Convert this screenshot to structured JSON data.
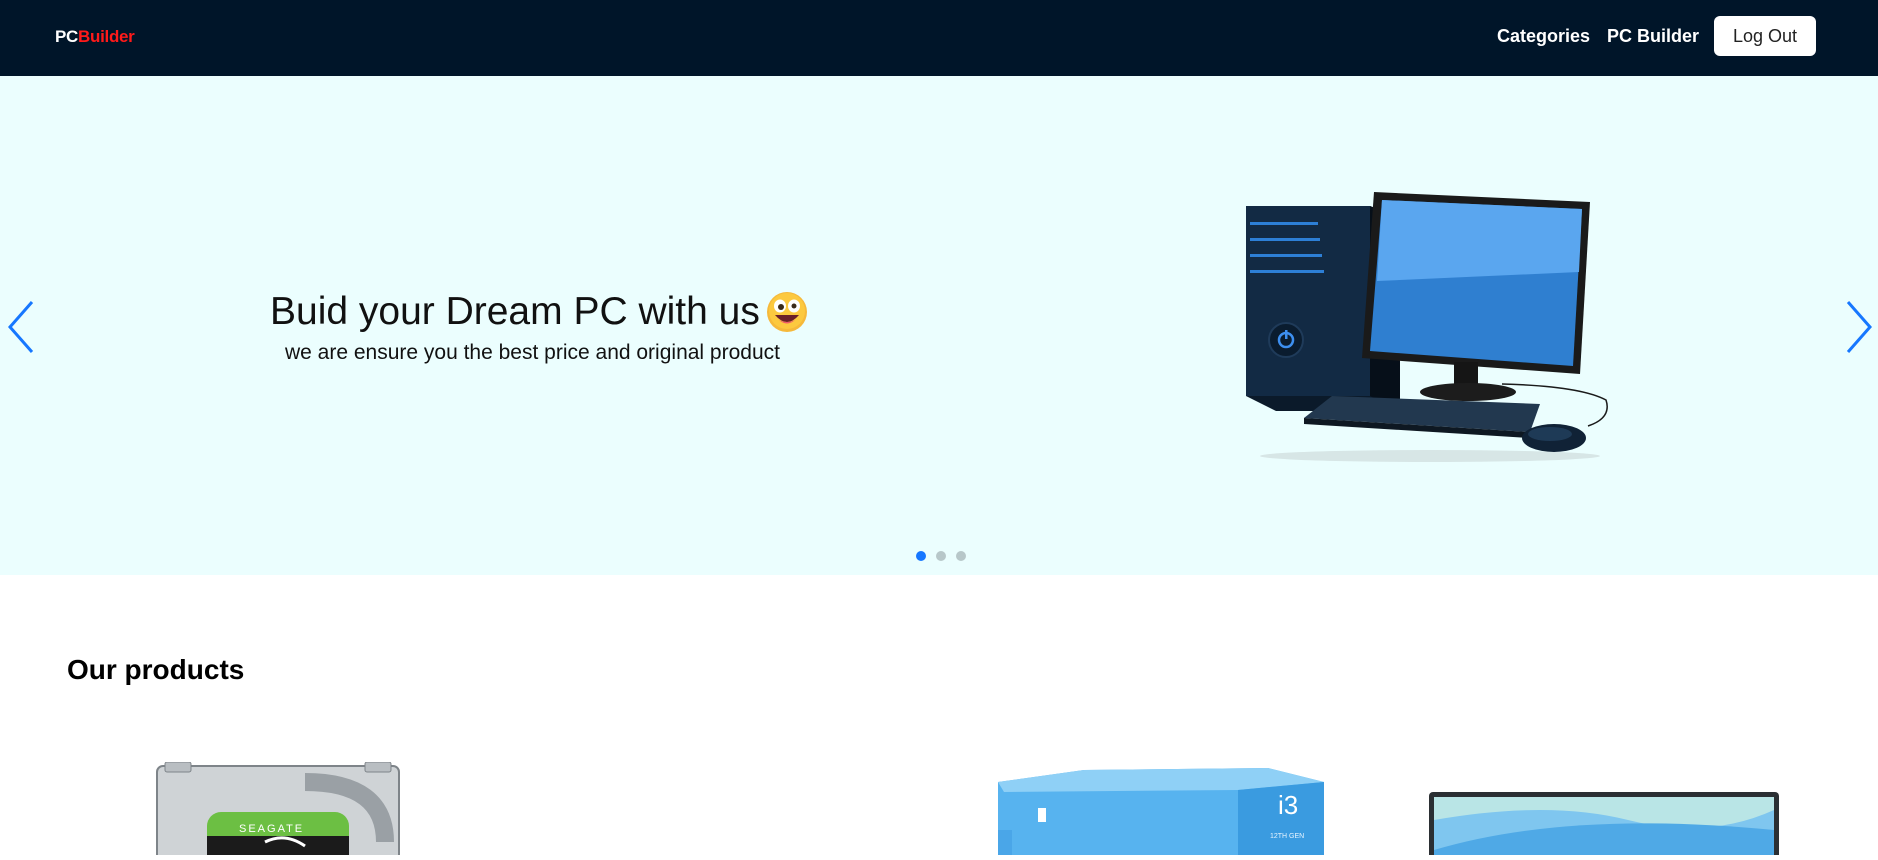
{
  "navbar": {
    "logo_pc": "PC",
    "logo_builder": "Builder",
    "links": [
      "Categories",
      "PC Builder"
    ],
    "logout_label": "Log Out"
  },
  "hero": {
    "title": "Buid your Dream PC with us",
    "subtitle": "we are ensure you the best price and original product",
    "slide_count": 3,
    "active_slide": 1
  },
  "products": {
    "section_title": "Our products",
    "items": [
      {
        "image": "seagate-hard-drive",
        "brand_text": "SEAGATE"
      },
      {
        "image": "intel-core-i3-box",
        "box_text": "i3",
        "gen_text": "12TH GEN"
      },
      {
        "image": "monitor"
      }
    ]
  },
  "colors": {
    "navbar_bg": "#001529",
    "hero_bg": "#ebfefe",
    "accent": "#1677ff",
    "logo_red": "#ff1a1a"
  }
}
